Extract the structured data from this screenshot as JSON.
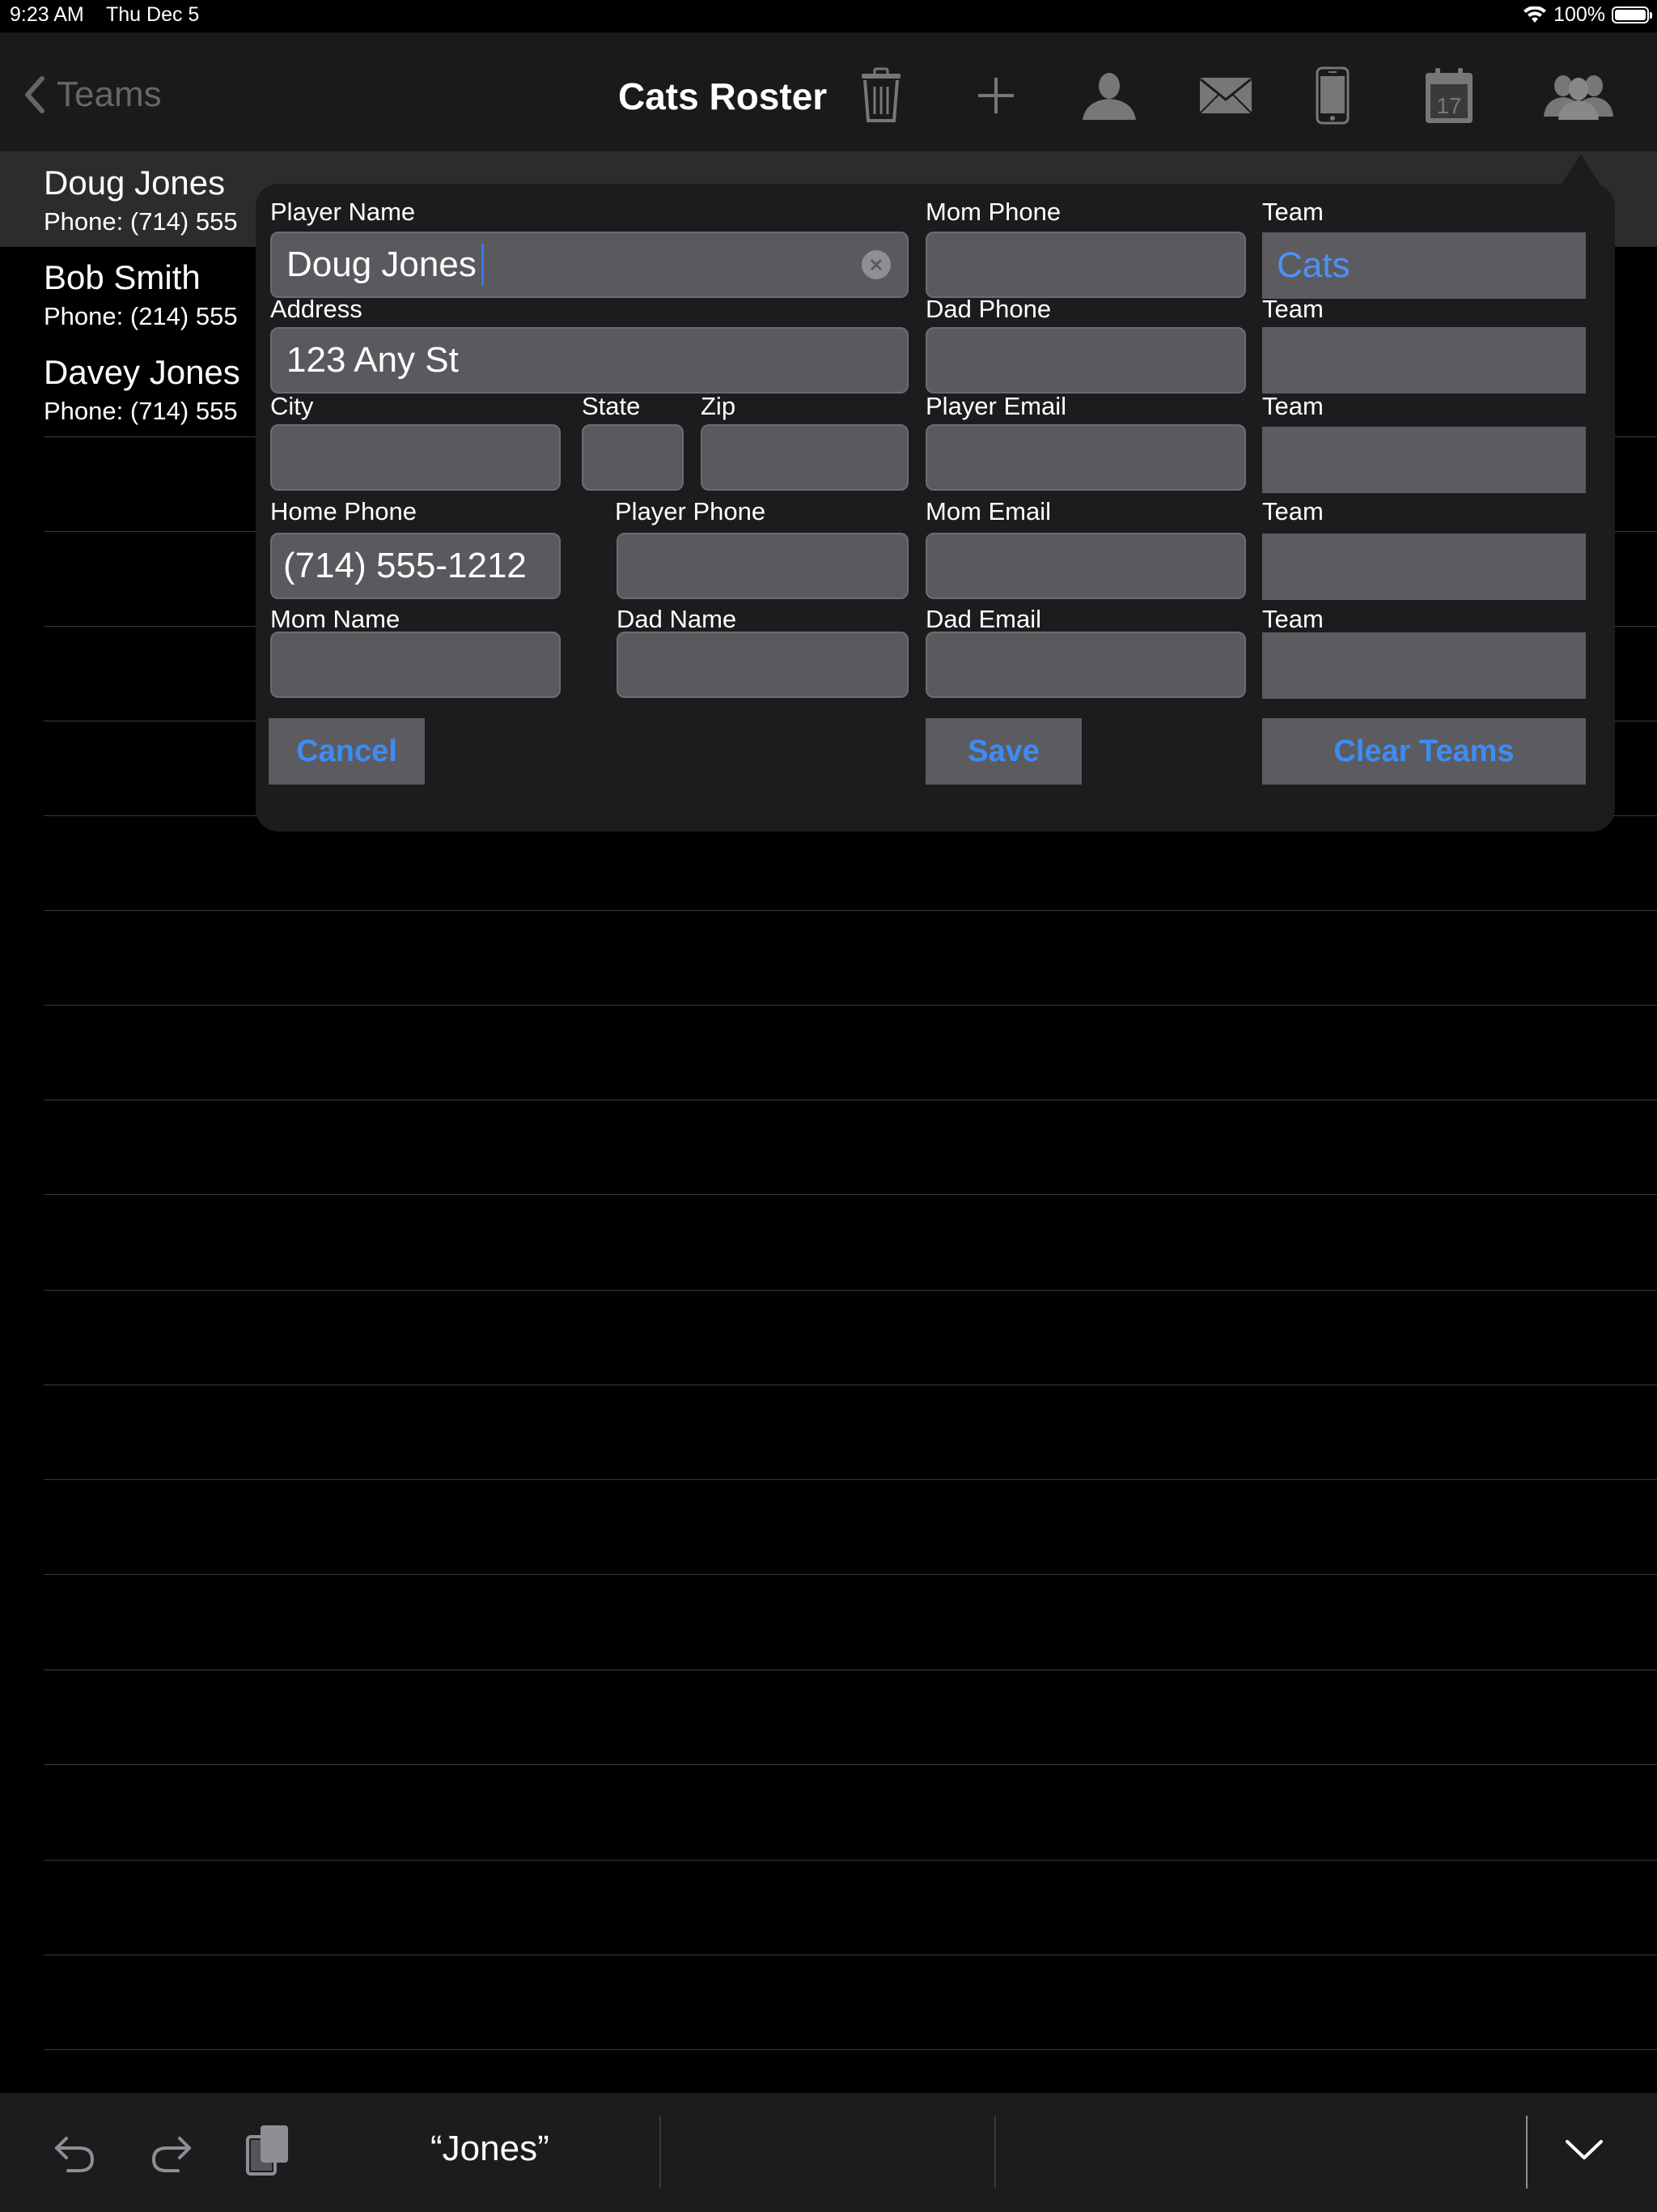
{
  "status": {
    "time": "9:23 AM",
    "date": "Thu Dec 5",
    "battery": "100%"
  },
  "nav": {
    "back_label": "Teams",
    "title": "Cats Roster",
    "icons": [
      "trash-icon",
      "plus-icon",
      "person-icon",
      "mail-icon",
      "phone-icon",
      "calendar-icon",
      "group-icon"
    ],
    "calendar_day": "17"
  },
  "roster": [
    {
      "name": "Doug Jones",
      "phone": "Phone:  (714) 555"
    },
    {
      "name": "Bob Smith",
      "phone": "Phone:  (214) 555"
    },
    {
      "name": "Davey Jones",
      "phone": "Phone:  (714) 555"
    }
  ],
  "form": {
    "labels": {
      "player_name": "Player Name",
      "address": "Address",
      "city": "City",
      "state": "State",
      "zip": "Zip",
      "home_phone": "Home Phone",
      "player_phone": "Player Phone",
      "mom_name": "Mom Name",
      "dad_name": "Dad Name",
      "mom_phone": "Mom Phone",
      "dad_phone": "Dad Phone",
      "player_email": "Player Email",
      "mom_email": "Mom Email",
      "dad_email": "Dad Email",
      "team": "Team"
    },
    "values": {
      "player_name": "Doug Jones",
      "address": "123 Any St",
      "city": "",
      "state": "",
      "zip": "",
      "home_phone": "(714) 555-1212",
      "player_phone": "",
      "mom_name": "",
      "dad_name": "",
      "mom_phone": "",
      "dad_phone": "",
      "player_email": "",
      "mom_email": "",
      "dad_email": "",
      "team1": "Cats",
      "team2": "",
      "team3": "",
      "team4": "",
      "team5": ""
    },
    "buttons": {
      "cancel": "Cancel",
      "save": "Save",
      "clear_teams": "Clear Teams"
    }
  },
  "keyboard_bar": {
    "suggestion": "“Jones”"
  },
  "colors": {
    "accent": "#3d8cf5",
    "field": "#5a5a5e",
    "popover": "#1c1c1e"
  }
}
